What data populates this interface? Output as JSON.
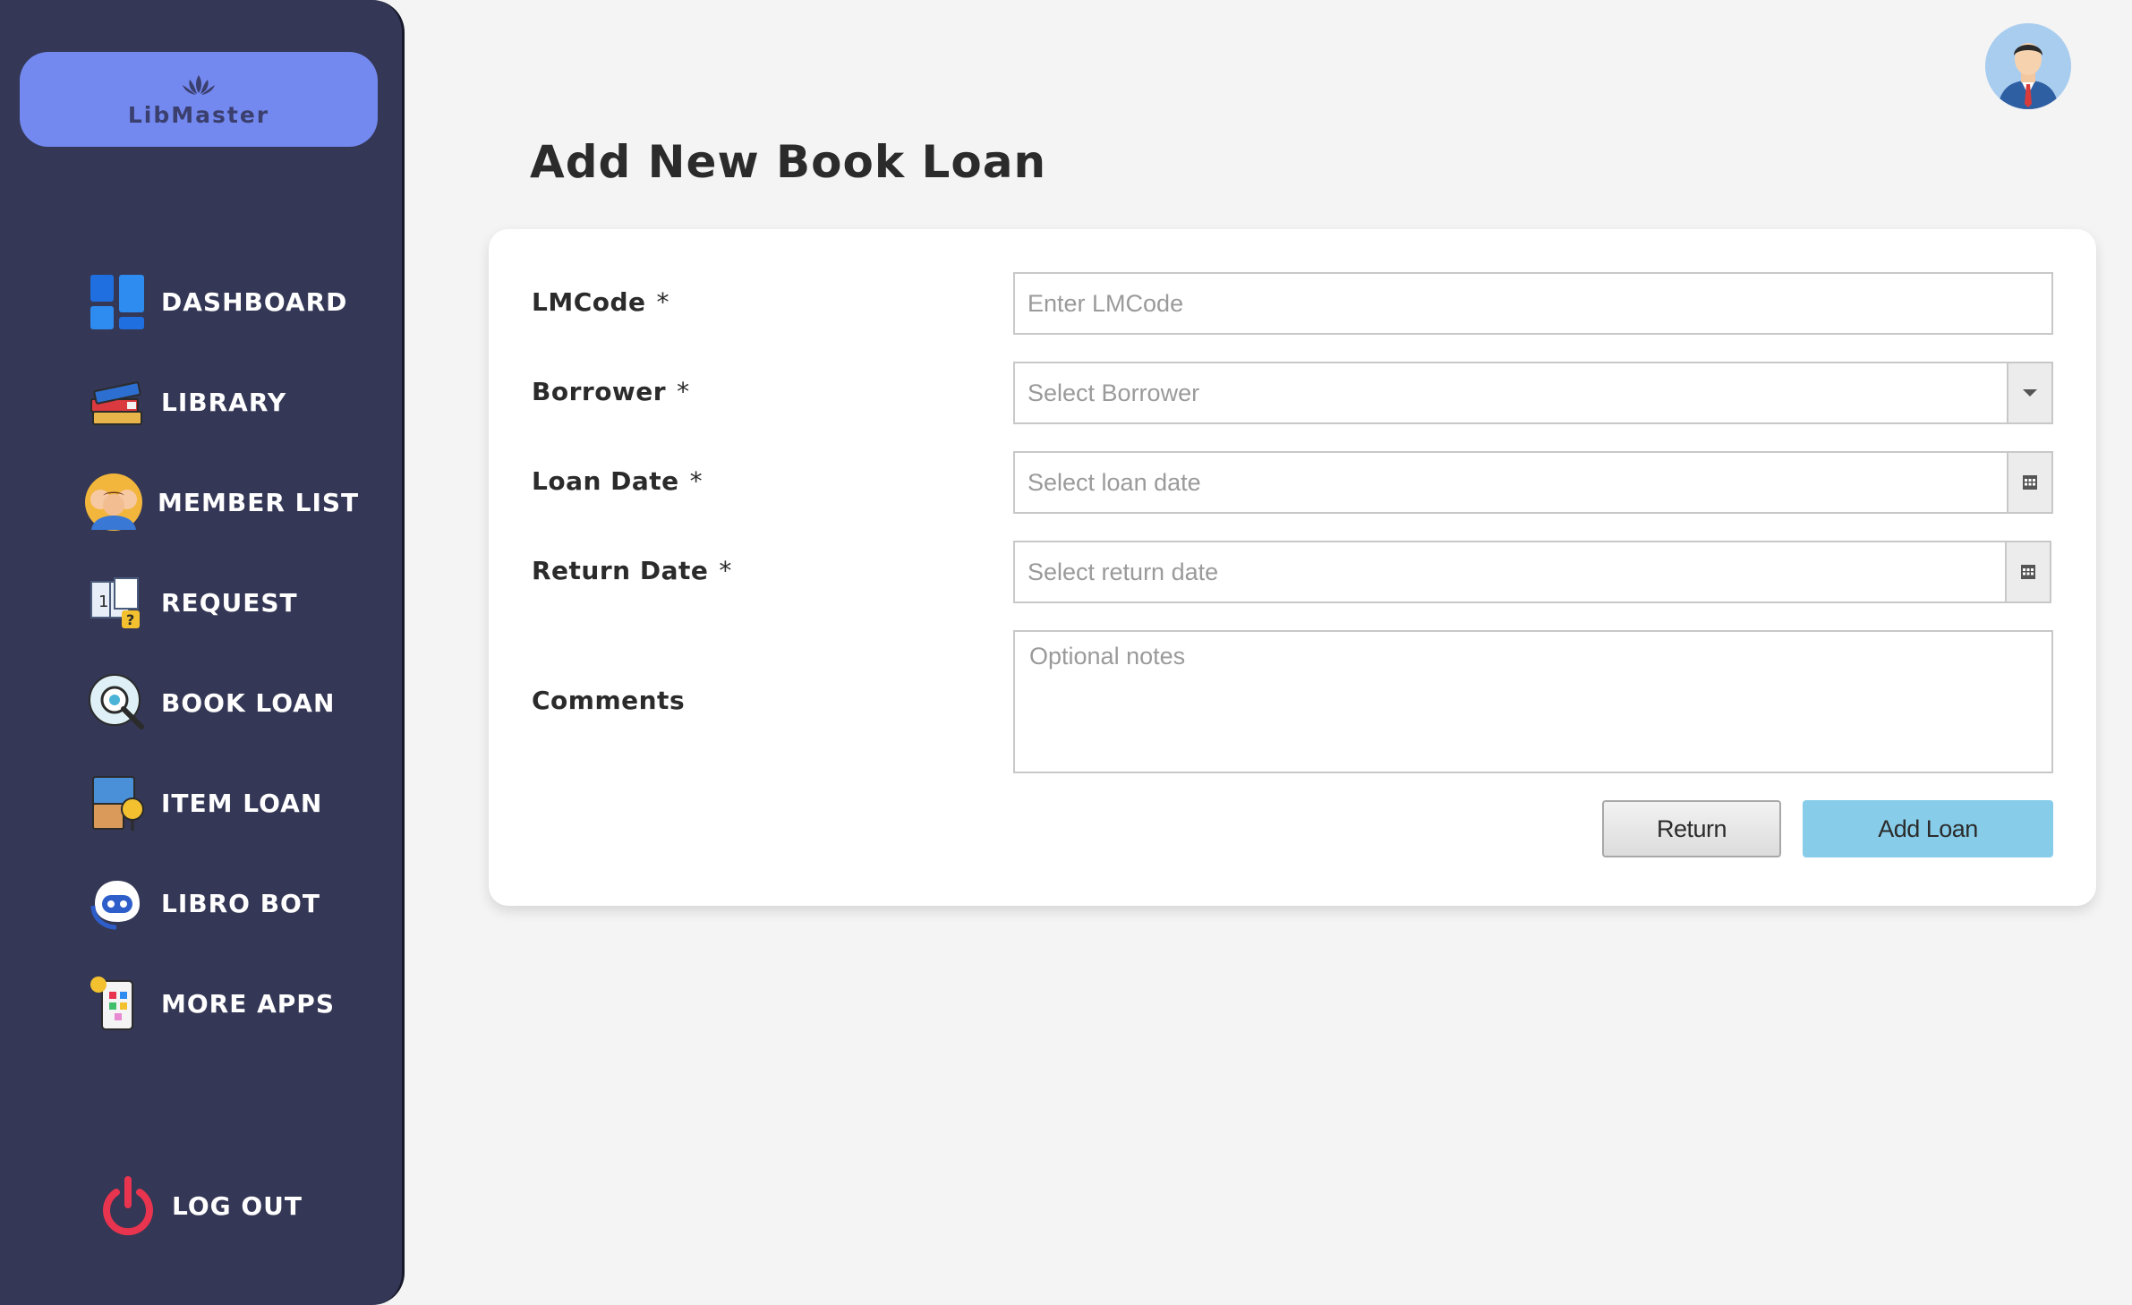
{
  "app": {
    "name": "LibMaster"
  },
  "sidebar": {
    "items": [
      {
        "label": "DASHBOARD",
        "icon": "dashboard-grid-icon"
      },
      {
        "label": "LIBRARY",
        "icon": "books-stack-icon"
      },
      {
        "label": "MEMBER LIST",
        "icon": "members-group-icon"
      },
      {
        "label": "REQUEST",
        "icon": "request-book-icon"
      },
      {
        "label": "BOOK LOAN",
        "icon": "book-loan-search-icon"
      },
      {
        "label": "ITEM LOAN",
        "icon": "item-loan-icon"
      },
      {
        "label": "LIBRO BOT",
        "icon": "robot-icon"
      },
      {
        "label": "MORE APPS",
        "icon": "apps-phone-icon"
      }
    ],
    "logout_label": "LOG OUT"
  },
  "header": {
    "avatar_icon": "user-avatar-icon"
  },
  "main": {
    "title": "Add New Book Loan"
  },
  "form": {
    "lmcode": {
      "label": "LMCode",
      "required": "*",
      "placeholder": "Enter LMCode"
    },
    "borrower": {
      "label": "Borrower",
      "required": "*",
      "placeholder": "Select Borrower"
    },
    "loan_date": {
      "label": "Loan Date",
      "required": "*",
      "placeholder": "Select loan date"
    },
    "return_date": {
      "label": "Return Date",
      "required": "*",
      "placeholder": "Select return date"
    },
    "comments": {
      "label": "Comments",
      "placeholder": "Optional notes"
    },
    "buttons": {
      "return_label": "Return",
      "add_label": "Add Loan"
    }
  },
  "colors": {
    "sidebar_bg": "#343755",
    "brand_bg": "#7389ef",
    "add_button": "#87cdea",
    "page_bg": "#f4f4f4",
    "logout_icon": "#e8344e"
  }
}
